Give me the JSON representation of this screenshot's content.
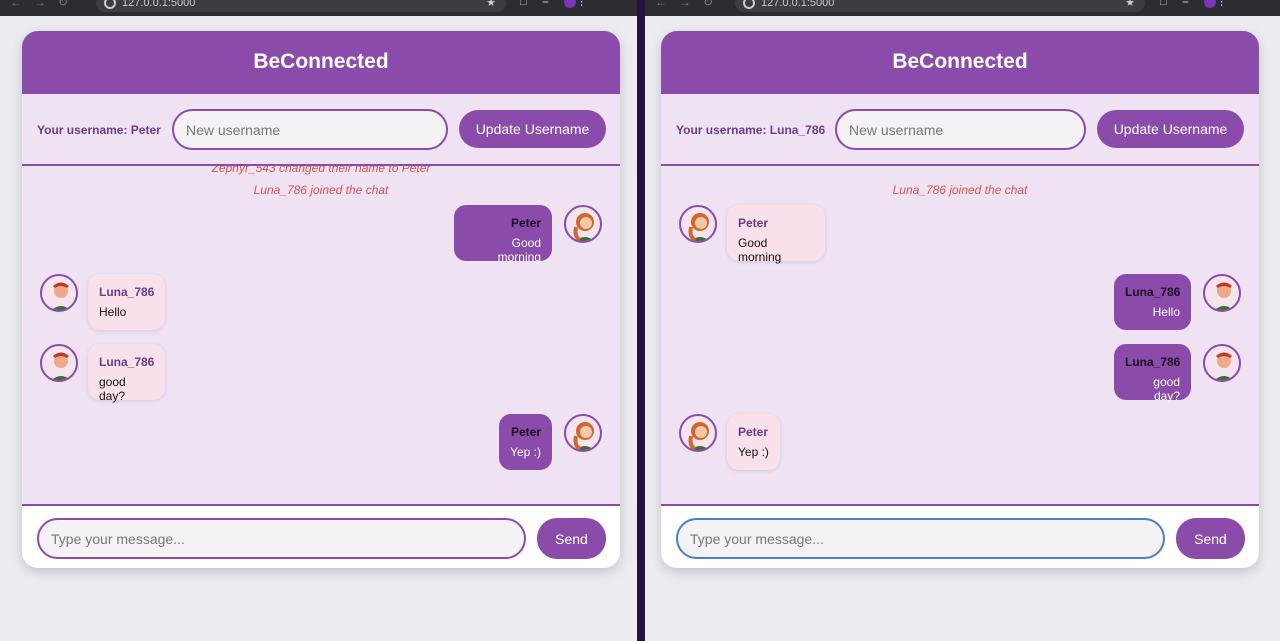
{
  "browser": {
    "url": "127.0.0.1:5000"
  },
  "app_title": "BeConnected",
  "common": {
    "new_username_placeholder": "New username",
    "update_button": "Update Username",
    "message_placeholder": "Type your message...",
    "send_button": "Send"
  },
  "left": {
    "username_label": "Your username: Peter",
    "system_messages": [
      "Zephyr_543 changed their name to Peter",
      "Luna_786 joined the chat"
    ],
    "messages": [
      {
        "user": "Peter",
        "text": "Good morning",
        "side": "mine"
      },
      {
        "user": "Luna_786",
        "text": "Hello",
        "side": "theirs"
      },
      {
        "user": "Luna_786",
        "text": "good day?",
        "side": "theirs"
      },
      {
        "user": "Peter",
        "text": "Yep :)",
        "side": "mine"
      }
    ]
  },
  "right": {
    "username_label": "Your username: Luna_786",
    "system_messages": [
      "Luna_786 joined the chat"
    ],
    "messages": [
      {
        "user": "Peter",
        "text": "Good morning",
        "side": "theirs"
      },
      {
        "user": "Luna_786",
        "text": "Hello",
        "side": "mine"
      },
      {
        "user": "Luna_786",
        "text": "good day?",
        "side": "mine"
      },
      {
        "user": "Peter",
        "text": "Yep :)",
        "side": "theirs"
      }
    ]
  },
  "icons": {
    "avatar_female": "avatar-woman-icon",
    "avatar_male": "avatar-man-icon"
  }
}
